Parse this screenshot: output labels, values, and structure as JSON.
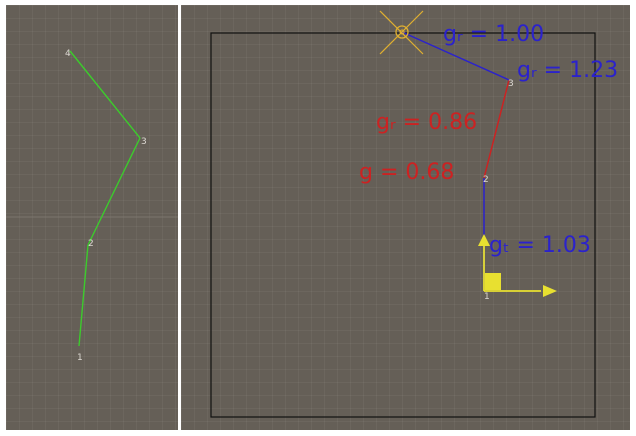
{
  "colors": {
    "panel_bg": "#655f57",
    "left_chain": "#3ccc2c",
    "blue": "#2b22cc",
    "red": "#cc2222",
    "yellow": "#e8e030",
    "frame": "#111111"
  },
  "left_view": {
    "nodes": [
      "1",
      "2",
      "3",
      "4"
    ]
  },
  "right_view": {
    "nodes": [
      "1",
      "2",
      "3"
    ],
    "gizmo_icon": "target-crosshair-icon",
    "labels": {
      "g_top": "gᵣ = 1.00",
      "g_right": "gᵣ = 1.23",
      "g_mid": "gᵣ = 0.86",
      "g_low": "g  = 0.68",
      "g_bottom": "gₜ = 1.03"
    }
  }
}
